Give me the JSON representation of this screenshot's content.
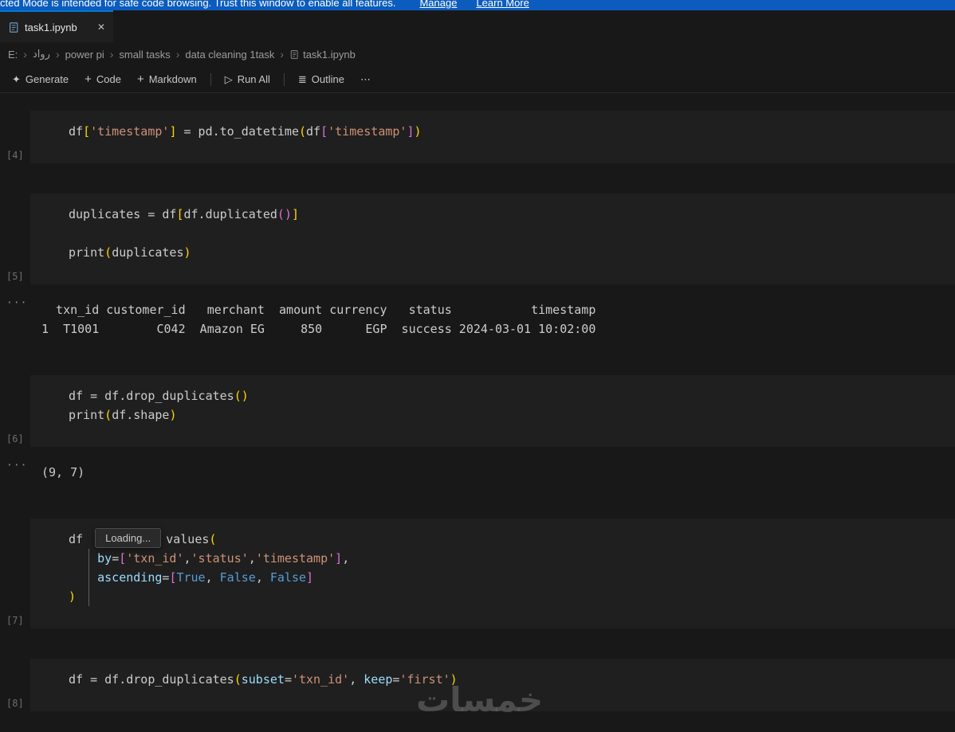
{
  "banner": {
    "message": "cted Mode is intended for safe code browsing. Trust this window to enable all features.",
    "manage_label": "Manage",
    "learn_more_label": "Learn More"
  },
  "tab": {
    "title": "task1.ipynb"
  },
  "icons": {
    "close": "✕",
    "chevron": "›",
    "sparkle": "✦",
    "plus": "+",
    "play": "▷",
    "outline": "≣",
    "more": "⋯"
  },
  "breadcrumb": {
    "items": [
      "E:",
      "رواد",
      "power pi",
      "small tasks",
      "data cleaning 1task",
      "task1.ipynb"
    ]
  },
  "toolbar": {
    "generate": "Generate",
    "code": "Code",
    "markdown": "Markdown",
    "run_all": "Run All",
    "outline": "Outline"
  },
  "colors": {
    "banner_blue": "#0b5cbd",
    "accent_blue": "#0078d4",
    "string_orange": "#ce9178",
    "bracket_gold": "#ffd700",
    "bracket_pink": "#da70d6",
    "parameter_blue": "#9cdcfe",
    "keyword_blue": "#569cd6",
    "cell_background": "#1f1f1f",
    "editor_background": "#181818"
  },
  "watermark": "خمسات",
  "notebook": {
    "output_marker": "···",
    "cells": [
      {
        "type": "code",
        "exec": "[4]",
        "lines": [
          [
            {
              "t": "df",
              "c": "pl"
            },
            {
              "t": "[",
              "c": "b1"
            },
            {
              "t": "'timestamp'",
              "c": "str"
            },
            {
              "t": "]",
              "c": "b1"
            },
            {
              "t": " = pd.to_datetime",
              "c": "pl"
            },
            {
              "t": "(",
              "c": "b1"
            },
            {
              "t": "df",
              "c": "pl"
            },
            {
              "t": "[",
              "c": "b2"
            },
            {
              "t": "'timestamp'",
              "c": "str"
            },
            {
              "t": "]",
              "c": "b2"
            },
            {
              "t": ")",
              "c": "b1"
            }
          ]
        ]
      },
      {
        "type": "code",
        "exec": "[5]",
        "lines": [
          [
            {
              "t": "duplicates = df",
              "c": "pl"
            },
            {
              "t": "[",
              "c": "b1"
            },
            {
              "t": "df.duplicated",
              "c": "pl"
            },
            {
              "t": "(",
              "c": "b2"
            },
            {
              "t": ")",
              "c": "b2"
            },
            {
              "t": "]",
              "c": "b1"
            }
          ],
          [],
          [
            {
              "t": "print",
              "c": "pl"
            },
            {
              "t": "(",
              "c": "b1"
            },
            {
              "t": "duplicates",
              "c": "pl"
            },
            {
              "t": ")",
              "c": "b1"
            }
          ]
        ]
      },
      {
        "type": "output",
        "text": "  txn_id customer_id   merchant  amount currency   status           timestamp\n1  T1001        C042  Amazon EG     850      EGP  success 2024-03-01 10:02:00"
      },
      {
        "type": "code",
        "exec": "[6]",
        "lines": [
          [
            {
              "t": "df = df.drop_duplicates",
              "c": "pl"
            },
            {
              "t": "(",
              "c": "b1"
            },
            {
              "t": ")",
              "c": "b1"
            }
          ],
          [
            {
              "t": "print",
              "c": "pl"
            },
            {
              "t": "(",
              "c": "b1"
            },
            {
              "t": "df.shape",
              "c": "pl"
            },
            {
              "t": ")",
              "c": "b1"
            }
          ]
        ]
      },
      {
        "type": "output",
        "text": "(9, 7)"
      },
      {
        "type": "code",
        "exec": "[7]",
        "indent_guide": true,
        "lines": [
          [
            {
              "t": "df ",
              "c": "pl"
            },
            {
              "t": "Loading...",
              "c": "tooltip"
            },
            {
              "t": "values",
              "c": "pl"
            },
            {
              "t": "(",
              "c": "b1"
            }
          ],
          [
            {
              "t": "    ",
              "c": "pl"
            },
            {
              "t": "by",
              "c": "param"
            },
            {
              "t": "=",
              "c": "pl"
            },
            {
              "t": "[",
              "c": "b2"
            },
            {
              "t": "'txn_id'",
              "c": "str"
            },
            {
              "t": ",",
              "c": "pl"
            },
            {
              "t": "'status'",
              "c": "str"
            },
            {
              "t": ",",
              "c": "pl"
            },
            {
              "t": "'timestamp'",
              "c": "str"
            },
            {
              "t": "]",
              "c": "b2"
            },
            {
              "t": ",",
              "c": "pl"
            }
          ],
          [
            {
              "t": "    ",
              "c": "pl"
            },
            {
              "t": "ascending",
              "c": "param"
            },
            {
              "t": "=",
              "c": "pl"
            },
            {
              "t": "[",
              "c": "b2"
            },
            {
              "t": "True",
              "c": "kw"
            },
            {
              "t": ", ",
              "c": "pl"
            },
            {
              "t": "False",
              "c": "kw"
            },
            {
              "t": ", ",
              "c": "pl"
            },
            {
              "t": "False",
              "c": "kw"
            },
            {
              "t": "]",
              "c": "b2"
            }
          ],
          [
            {
              "t": ")",
              "c": "b1"
            }
          ]
        ]
      },
      {
        "type": "code",
        "exec": "[8]",
        "lines": [
          [
            {
              "t": "df = df.drop_duplicates",
              "c": "pl"
            },
            {
              "t": "(",
              "c": "b1"
            },
            {
              "t": "subset",
              "c": "param"
            },
            {
              "t": "=",
              "c": "pl"
            },
            {
              "t": "'txn_id'",
              "c": "str"
            },
            {
              "t": ", ",
              "c": "pl"
            },
            {
              "t": "keep",
              "c": "param"
            },
            {
              "t": "=",
              "c": "pl"
            },
            {
              "t": "'first'",
              "c": "str"
            },
            {
              "t": ")",
              "c": "b1"
            }
          ]
        ]
      }
    ]
  }
}
